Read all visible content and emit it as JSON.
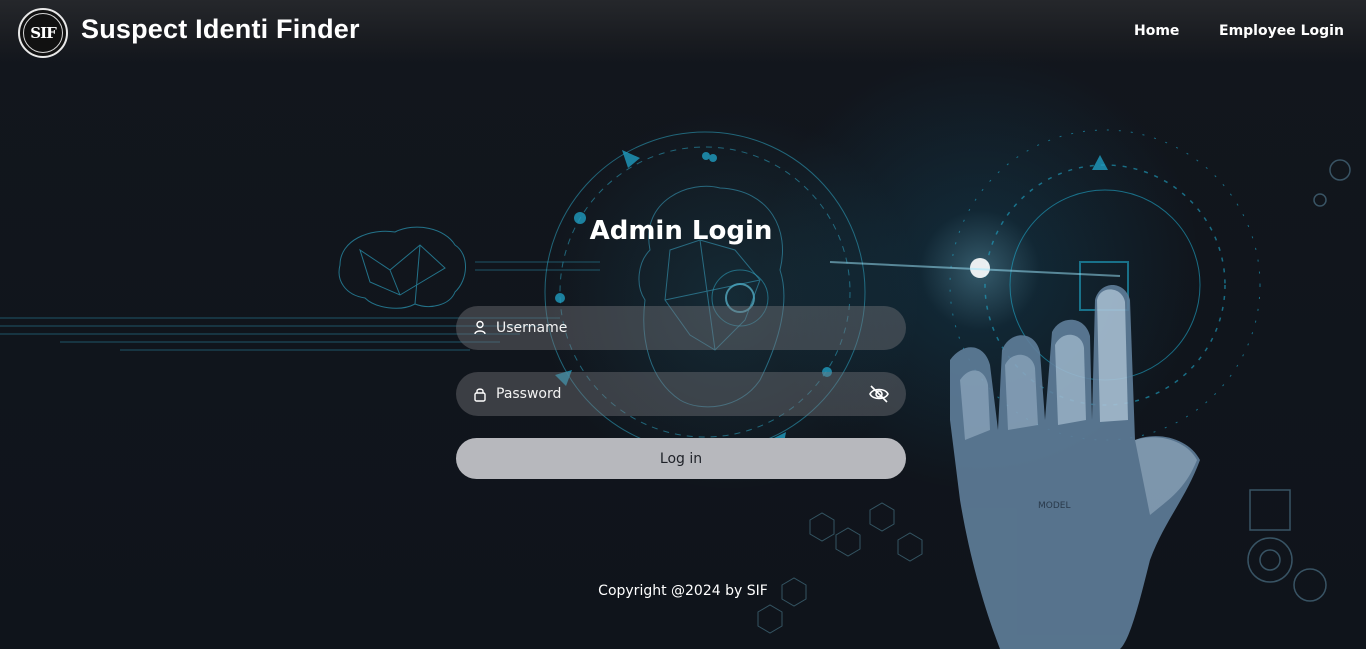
{
  "brand": {
    "logo_text": "SIF",
    "title": "Suspect Identi Finder"
  },
  "nav": {
    "home": "Home",
    "employee_login": "Employee Login"
  },
  "login": {
    "title": "Admin Login",
    "username_placeholder": "Username",
    "password_placeholder": "Password",
    "submit_label": "Log in"
  },
  "footer": {
    "copyright": "Copyright @2024 by SIF"
  },
  "colors": {
    "background": "#0e131b",
    "accent": "#2fb7d6",
    "button": "#b7b8bd"
  },
  "icons": [
    "user-icon",
    "lock-icon",
    "eye-slash-icon"
  ]
}
